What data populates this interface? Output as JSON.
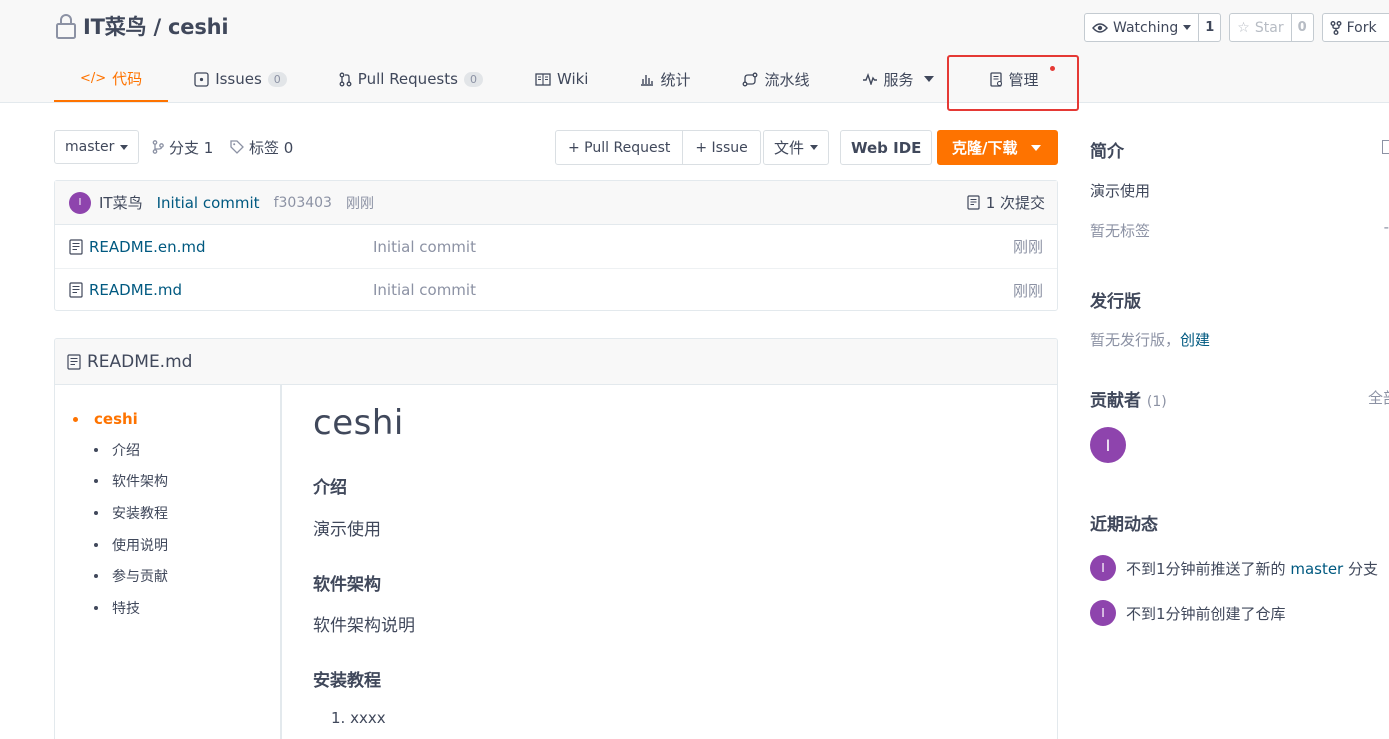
{
  "repo": {
    "path": "IT菜鸟 / ceshi"
  },
  "actions": {
    "watch": {
      "label": "Watching",
      "count": "1"
    },
    "star": {
      "label": "Star",
      "count": "0"
    },
    "fork": {
      "label": "Fork"
    }
  },
  "tabs": [
    {
      "label": "代码",
      "icon": "code-icon"
    },
    {
      "label": "Issues",
      "badge": "0",
      "icon": "issues-icon"
    },
    {
      "label": "Pull Requests",
      "badge": "0",
      "icon": "pull-request-icon"
    },
    {
      "label": "Wiki",
      "icon": "wiki-icon"
    },
    {
      "label": "统计",
      "icon": "stats-icon"
    },
    {
      "label": "流水线",
      "icon": "pipeline-icon"
    },
    {
      "label": "服务",
      "icon": "pulse-icon"
    },
    {
      "label": "管理",
      "icon": "manage-icon"
    }
  ],
  "toolbar": {
    "branch": "master",
    "branches": "分支 1",
    "tags": "标签 0",
    "new_pr": "+ Pull Request",
    "new_issue": "+ Issue",
    "files": "文件",
    "web_ide": "Web IDE",
    "clone": "克隆/下载"
  },
  "commit": {
    "avatar_letter": "I",
    "author": "IT菜鸟",
    "message": "Initial commit",
    "sha": "f303403",
    "time": "刚刚",
    "count": "1 次提交"
  },
  "files": [
    {
      "name": "README.en.md",
      "commit": "Initial commit",
      "time": "刚刚"
    },
    {
      "name": "README.md",
      "commit": "Initial commit",
      "time": "刚刚"
    }
  ],
  "readme": {
    "title": "README.md",
    "toc_top": "ceshi",
    "toc": [
      "介绍",
      "软件架构",
      "安装教程",
      "使用说明",
      "参与贡献",
      "特技"
    ],
    "h1": "ceshi",
    "sec1_title": "介绍",
    "sec1_text": "演示使用",
    "sec2_title": "软件架构",
    "sec2_text": "软件架构说明",
    "sec3_title": "安装教程",
    "sec3_item": "1. xxxx"
  },
  "sidebar": {
    "intro_title": "简介",
    "intro_text": "演示使用",
    "no_tags": "暂无标签",
    "release_title": "发行版",
    "no_release": "暂无发行版，",
    "create": "创建",
    "contrib_title": "贡献者",
    "contrib_count": "(1)",
    "all": "全部",
    "contrib_letter": "I",
    "activity_title": "近期动态",
    "activity": [
      {
        "letter": "I",
        "before": "不到1分钟前推送了新的",
        "branch": "master",
        "after": "分支"
      },
      {
        "letter": "I",
        "before": "不到1分钟前创建了仓库",
        "branch": "",
        "after": ""
      }
    ]
  },
  "colors": {
    "accent": "#fe7300",
    "link": "#005980",
    "avatar": "#8e44ad",
    "highlight": "#e53935"
  }
}
